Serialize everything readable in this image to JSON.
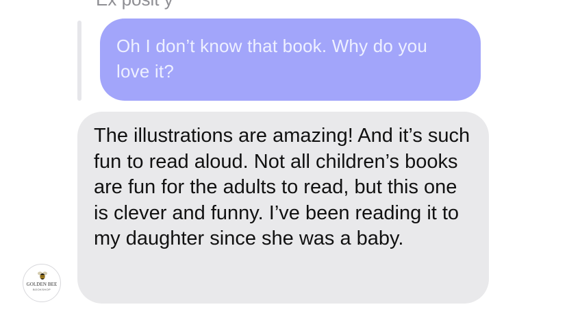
{
  "messages": {
    "previous_cutoff": "Ex posit   y",
    "quoted": {
      "text": "Oh I don’t know that book. Why do you love it?"
    },
    "reply": {
      "text": "The illustrations are amazing! And it’s such fun to read aloud. Not all children’s books are fun for the adults to read, but this one is clever and funny. I’ve been reading it to my daughter since she was a baby."
    }
  },
  "avatar": {
    "icon": "bee-icon",
    "name": "GOLDEN BEE",
    "sub": "BOOKSHOP"
  },
  "colors": {
    "outgoing_bubble": "#a2a5fa",
    "outgoing_text": "#eef0ff",
    "incoming_bubble": "#e9e9eb",
    "incoming_text": "#111111",
    "reply_bar": "#e6e6ea"
  }
}
